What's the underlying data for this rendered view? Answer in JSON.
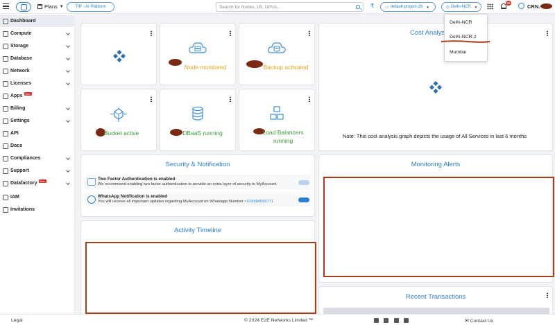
{
  "header": {
    "plans_label": "Plans",
    "tir_label": "TIR - AI Platform",
    "search_placeholder": "Search for Nodes, LB, GPUs...",
    "rupee_symbol": "₹",
    "project_label": "default-project-26",
    "region_label": "Delhi-NCR",
    "notification_count": "99",
    "user_label": "CRN."
  },
  "region_dropdown": {
    "options": [
      "Delhi-NCR",
      "Delhi-NCR-2",
      "Mumbai"
    ]
  },
  "sidebar": {
    "items": [
      {
        "label": "Dashboard",
        "icon": "dashboard-icon"
      },
      {
        "label": "Compute",
        "icon": "compute-icon"
      },
      {
        "label": "Storage",
        "icon": "storage-icon"
      },
      {
        "label": "Database",
        "icon": "database-icon"
      },
      {
        "label": "Network",
        "icon": "network-icon"
      },
      {
        "label": "Licenses",
        "icon": "licenses-icon"
      },
      {
        "label": "Apps",
        "icon": "apps-icon",
        "badge": "New"
      },
      {
        "label": "Billing",
        "icon": "billing-icon"
      },
      {
        "label": "Settings",
        "icon": "settings-icon"
      },
      {
        "label": "API",
        "icon": "api-icon"
      },
      {
        "label": "Docs",
        "icon": "docs-icon"
      },
      {
        "label": "Compliances",
        "icon": "compliances-icon"
      },
      {
        "label": "Support",
        "icon": "support-icon"
      },
      {
        "label": "Datafactory",
        "icon": "datafactory-icon",
        "badge": "New"
      },
      {
        "label": "IAM",
        "icon": "iam-icon"
      },
      {
        "label": "Invitations",
        "icon": "invitations-icon"
      }
    ]
  },
  "services": {
    "node": "Node monitored",
    "backup": "Backup activated",
    "bucket": "Bucket active",
    "dbaas": "DBaaS running",
    "lb_line1": "Load Balancers",
    "lb_line2": "running"
  },
  "cost": {
    "title": "Cost Analysis",
    "note": "Note: This cost analysis graph depicts the usage of All Services in last 6 months"
  },
  "security": {
    "title": "Security & Notification",
    "twofa_title": "Two Factor Authentication is enabled",
    "twofa_desc": "We recommend enabling two factor authentication to provide an extra layer of security to MyAccount",
    "wa_title": "WhatsApp Notification is enabled",
    "wa_desc": "You will receive all important updates regarding MyAccount on Whatsapp Number ",
    "wa_number": "+919994596771"
  },
  "monitoring": {
    "title": "Monitoring Alerts"
  },
  "activity": {
    "title": "Activity Timeline"
  },
  "transactions": {
    "title": "Recent Transactions"
  },
  "footer": {
    "legal": "Legal",
    "copyright": "© 2024 E2E Networks Limited ™",
    "contact": "Contact Us"
  },
  "colors": {
    "accent": "#2c7fd6",
    "success": "#3a9a3a",
    "warning": "#e0a21b",
    "annotation": "#a83c1c"
  }
}
